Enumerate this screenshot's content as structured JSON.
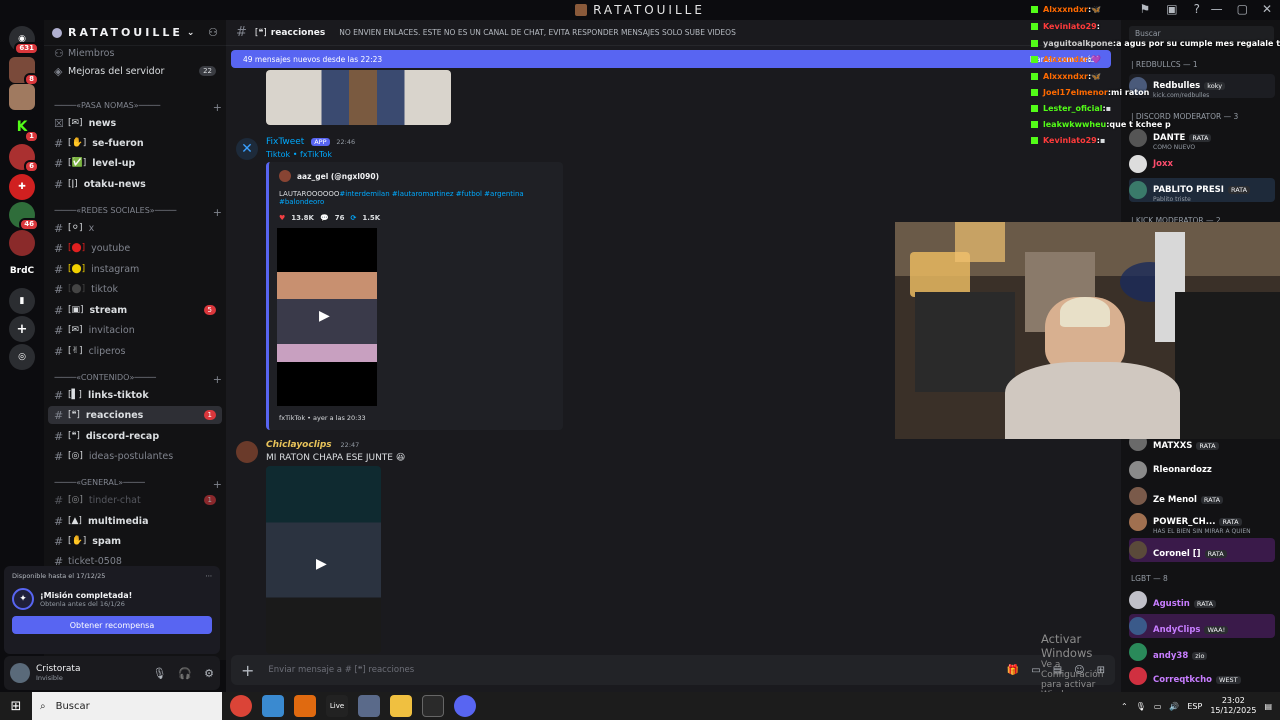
{
  "window": {
    "title": "RATATOUILLE"
  },
  "server": {
    "name": "RATATOUILLE",
    "rail_badges": [
      "631",
      "8",
      "1",
      "6",
      "46"
    ],
    "rail_label": "BrdC"
  },
  "sidebar": {
    "top_items": [
      {
        "label": "Miembros"
      },
      {
        "label": "Mejoras del servidor",
        "count": "22"
      }
    ],
    "categories": {
      "pasa_nomas": "╶────«PASA NOMAS»────╴",
      "redes_sociales": "╶────«REDES SOCIALES»────╴",
      "contenido": "╶────«CONTENIDO»────╴",
      "general": "╶────«GENERAL»────╴"
    },
    "channels": [
      {
        "emoji": "[✉]",
        "name": "news"
      },
      {
        "emoji": "[✋]",
        "name": "se-fueron"
      },
      {
        "emoji": "[✅]",
        "name": "level-up"
      },
      {
        "emoji": "[ǀ]",
        "name": "otaku-news"
      },
      {
        "emoji": "[⚪]",
        "name": "x"
      },
      {
        "emoji": "[⬤]",
        "name": "youtube"
      },
      {
        "emoji": "[⬤]",
        "name": "instagram"
      },
      {
        "emoji": "[⬤]",
        "name": "tiktok"
      },
      {
        "emoji": "[▣]",
        "name": "stream",
        "count": "5"
      },
      {
        "emoji": "[✉]",
        "name": "invitacion"
      },
      {
        "emoji": "[✌]",
        "name": "cliperos"
      },
      {
        "emoji": "[▌]",
        "name": "links-tiktok"
      },
      {
        "emoji": "[❝]",
        "name": "reacciones",
        "count": "1"
      },
      {
        "emoji": "[❝]",
        "name": "discord-recap"
      },
      {
        "emoji": "[◎]",
        "name": "ideas-postulantes"
      },
      {
        "emoji": "[◎]",
        "name": "tinder-chat",
        "count": "1"
      },
      {
        "emoji": "[▲]",
        "name": "multimedia"
      },
      {
        "emoji": "[✋]",
        "name": "spam"
      },
      {
        "emoji": "",
        "name": "ticket-0508"
      }
    ],
    "promo": {
      "available": "Disponible hasta el 17/12/25",
      "title": "¡Misión completada!",
      "subtitle": "Obtenla antes del 16/1/26",
      "button": "Obtener recompensa"
    },
    "user": {
      "name": "Cristorata",
      "status": "Invisible"
    }
  },
  "chat": {
    "channel_name": "reacciones",
    "channel_emoji": "[❝]",
    "topic": "NO ENVIEN ENLACES. ESTE NO ES UN CANAL DE CHAT, EVITA RESPONDER MENSAJES SOLO SUBE VIDEOS",
    "new_messages": "49 mensajes nuevos desde las 22:23",
    "mark_read": "Marcar como leído",
    "messages": [
      {
        "author": "FixTweet",
        "badge": "APP",
        "time": "22:46",
        "link_text": "Tiktok • fxTikTok",
        "embed": {
          "author": "aaz_gel (@ngxl090)",
          "description": "LAUTAROOOOOO",
          "tags": "#interdemilan #lautaromartinez #futbol #argentina #balondeoro",
          "likes": "13.8K",
          "comments": "76",
          "shares": "1.5K",
          "footer": "fxTikTok • ayer a las 20:33"
        }
      },
      {
        "author": "Chiclayoclips",
        "time": "22:47",
        "text": "MI RATON CHAPA ESE JUNTE"
      }
    ],
    "composer_placeholder": "Enviar mensaje a # [❝] reacciones"
  },
  "overlay_chat": [
    {
      "user": "Alxxxndxr",
      "text": "",
      "color": "#ff6a00"
    },
    {
      "user": "Kevinlato29",
      "text": "",
      "color": "#ff3b3b"
    },
    {
      "user": "yaguitoalkpone",
      "text": "a agus por su cumple mes regalale tu chula",
      "color": "#cccccc"
    },
    {
      "user": "Alxxxndxr",
      "text": "",
      "color": "#ff6a00"
    },
    {
      "user": "Alxxxndxr",
      "text": "",
      "color": "#ff6a00"
    },
    {
      "user": "Joel17elmenor",
      "text": "mi raton",
      "color": "#ff6a00"
    },
    {
      "user": "Lester_oficial",
      "text": "",
      "color": "#53fc18"
    },
    {
      "user": "leakwkwwheu",
      "text": "que t kchee p",
      "color": "#53fc18"
    },
    {
      "user": "Kevinlato29",
      "text": "",
      "color": "#ff3b3b"
    }
  ],
  "members": {
    "search_placeholder": "Buscar",
    "groups": [
      {
        "label": "| REDBULLCS — 1"
      },
      {
        "label": "| DISCORD MODERATOR — 3"
      },
      {
        "label": "| KICK MODERATOR — 2"
      },
      {
        "label": "LGBT — 8"
      }
    ],
    "list": [
      {
        "name": "Redbulles",
        "tag": "koky",
        "sub": "kick.com/redbulles",
        "color": "#ffffff"
      },
      {
        "name": "DANTE",
        "tag": "RATA",
        "sub": "COMO NUEVO",
        "color": "#ffffff"
      },
      {
        "name": "Joxx",
        "tag": "",
        "sub": "",
        "color": "#ff4d6d"
      },
      {
        "name": "PABLITO PRESI",
        "tag": "RATA",
        "sub": "Pablito triste",
        "color": "#ffffff"
      },
      {
        "name": "MATXXS",
        "tag": "RATA",
        "sub": "",
        "color": "#ffffff"
      },
      {
        "name": "Rleonardozz",
        "tag": "",
        "sub": "",
        "color": "#ffffff"
      },
      {
        "name": "Ze Menol",
        "tag": "RATA",
        "sub": "",
        "color": "#ffffff"
      },
      {
        "name": "POWER_CH...",
        "tag": "RATA",
        "sub": "HAS EL BIEN SIN MIRAR A QUIEN",
        "color": "#ffffff"
      },
      {
        "name": "Coronel []",
        "tag": "RATA",
        "sub": "",
        "color": "#ffffff"
      },
      {
        "name": "Agustin",
        "tag": "RATA",
        "sub": "",
        "color": "#c77dff"
      },
      {
        "name": "AndyClips",
        "tag": "WAA!",
        "sub": "",
        "color": "#c77dff"
      },
      {
        "name": "andy38",
        "tag": "zio",
        "sub": "",
        "color": "#c77dff"
      },
      {
        "name": "Correqtkcho",
        "tag": "WEST",
        "sub": "",
        "color": "#c77dff"
      }
    ]
  },
  "watermark": {
    "line1": "Activar Windows",
    "line2": "Ve a Configuración para activar Windows."
  },
  "taskbar": {
    "search": "Buscar",
    "live_label": "Live",
    "lang": "ESP",
    "time": "23:02",
    "date": "15/12/2025"
  }
}
